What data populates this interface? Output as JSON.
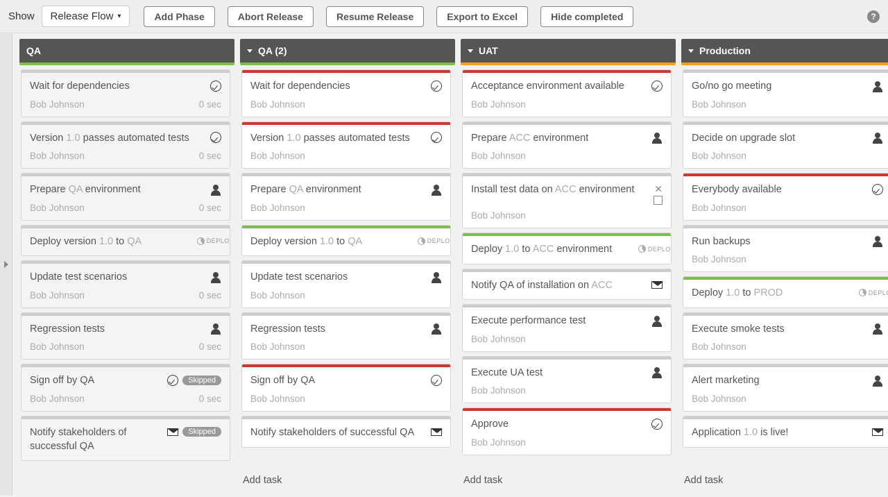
{
  "toolbar": {
    "show_label": "Show",
    "view_dropdown": "Release Flow",
    "add_phase": "Add Phase",
    "abort_release": "Abort Release",
    "resume_release": "Resume Release",
    "export_excel": "Export to Excel",
    "hide_completed": "Hide completed"
  },
  "add_task_label": "Add task",
  "phases": [
    {
      "name": "QA",
      "strip": "green",
      "expanded": false,
      "tasks": [
        {
          "pre": "",
          "mid": "",
          "post": "Wait for dependencies",
          "bar": "grey",
          "bg": "completed",
          "icon": "check",
          "assignee": "Bob Johnson",
          "meta": "0 sec"
        },
        {
          "pre": "Version ",
          "mid": "1.0",
          "post": " passes automated tests",
          "bar": "grey",
          "bg": "completed",
          "icon": "check",
          "assignee": "Bob Johnson",
          "meta": "0 sec"
        },
        {
          "pre": "Prepare ",
          "mid": "QA",
          "post": " environment",
          "bar": "grey",
          "bg": "completed",
          "icon": "person",
          "assignee": "Bob Johnson",
          "meta": "0 sec"
        },
        {
          "pre": "Deploy version ",
          "mid": "1.0",
          "post": " to ",
          "mid2": "QA",
          "bar": "grey",
          "bg": "completed",
          "icon": "deploy",
          "assignee": "",
          "meta": ""
        },
        {
          "pre": "",
          "mid": "",
          "post": "Update test scenarios",
          "bar": "grey",
          "bg": "completed",
          "icon": "person",
          "assignee": "Bob Johnson",
          "meta": "0 sec"
        },
        {
          "pre": "",
          "mid": "",
          "post": "Regression tests",
          "bar": "grey",
          "bg": "completed",
          "icon": "person",
          "assignee": "Bob Johnson",
          "meta": "0 sec"
        },
        {
          "pre": "",
          "mid": "",
          "post": "Sign off by QA",
          "bar": "grey",
          "bg": "completed",
          "icon": "check",
          "badge": "Skipped",
          "assignee": "Bob Johnson",
          "meta": "0 sec"
        },
        {
          "pre": "",
          "mid": "",
          "post": "Notify stakeholders of successful QA",
          "bar": "grey",
          "bg": "completed",
          "icon": "mail",
          "badge": "Skipped",
          "assignee": "",
          "meta": ""
        }
      ]
    },
    {
      "name": "QA (2)",
      "strip": "green",
      "expanded": true,
      "tasks": [
        {
          "pre": "",
          "mid": "",
          "post": "Wait for dependencies",
          "bar": "red",
          "icon": "check",
          "assignee": "Bob Johnson",
          "meta": ""
        },
        {
          "pre": "Version ",
          "mid": "1.0",
          "post": " passes automated tests",
          "bar": "red",
          "icon": "check",
          "assignee": "Bob Johnson",
          "meta": ""
        },
        {
          "pre": "Prepare ",
          "mid": "QA",
          "post": " environment",
          "bar": "grey",
          "icon": "person",
          "assignee": "Bob Johnson",
          "meta": ""
        },
        {
          "pre": "Deploy version ",
          "mid": "1.0",
          "post": " to ",
          "mid2": "QA",
          "bar": "green",
          "icon": "deploy",
          "assignee": "",
          "meta": ""
        },
        {
          "pre": "",
          "mid": "",
          "post": "Update test scenarios",
          "bar": "grey",
          "icon": "person",
          "assignee": "Bob Johnson",
          "meta": ""
        },
        {
          "pre": "",
          "mid": "",
          "post": "Regression tests",
          "bar": "grey",
          "icon": "person",
          "assignee": "Bob Johnson",
          "meta": ""
        },
        {
          "pre": "",
          "mid": "",
          "post": "Sign off by QA",
          "bar": "red",
          "icon": "check",
          "assignee": "Bob Johnson",
          "meta": ""
        },
        {
          "pre": "",
          "mid": "",
          "post": "Notify stakeholders of successful QA",
          "bar": "grey",
          "icon": "mail",
          "assignee": "",
          "meta": ""
        }
      ]
    },
    {
      "name": "UAT",
      "strip": "orange",
      "expanded": true,
      "tasks": [
        {
          "pre": "",
          "mid": "",
          "post": "Acceptance environment available",
          "bar": "red",
          "icon": "check",
          "assignee": "Bob Johnson",
          "meta": ""
        },
        {
          "pre": "Prepare ",
          "mid": "ACC",
          "post": " environment",
          "bar": "grey",
          "icon": "person",
          "assignee": "Bob Johnson",
          "meta": ""
        },
        {
          "pre": "Install test data on ",
          "mid": "ACC",
          "post": " environment",
          "bar": "grey",
          "icon": "person",
          "extras": true,
          "assignee": "Bob Johnson",
          "meta": ""
        },
        {
          "pre": "Deploy ",
          "mid": "1.0",
          "post": " to ",
          "mid2": "ACC",
          "post2": " environment",
          "bar": "green",
          "icon": "deploy",
          "assignee": "",
          "meta": ""
        },
        {
          "pre": "Notify QA of installation on ",
          "mid": "ACC",
          "post": "",
          "bar": "grey",
          "icon": "mail",
          "assignee": "",
          "meta": ""
        },
        {
          "pre": "",
          "mid": "",
          "post": "Execute performance test",
          "bar": "grey",
          "icon": "person",
          "assignee": "Bob Johnson",
          "meta": ""
        },
        {
          "pre": "",
          "mid": "",
          "post": "Execute UA test",
          "bar": "grey",
          "icon": "person",
          "assignee": "Bob Johnson",
          "meta": ""
        },
        {
          "pre": "",
          "mid": "",
          "post": "Approve",
          "bar": "red",
          "icon": "check",
          "assignee": "Bob Johnson",
          "meta": ""
        }
      ]
    },
    {
      "name": "Production",
      "strip": "orange",
      "expanded": true,
      "tasks": [
        {
          "pre": "",
          "mid": "",
          "post": "Go/no go meeting",
          "bar": "grey",
          "icon": "person",
          "assignee": "Bob Johnson",
          "meta": ""
        },
        {
          "pre": "",
          "mid": "",
          "post": "Decide on upgrade slot",
          "bar": "grey",
          "icon": "person",
          "assignee": "Bob Johnson",
          "meta": ""
        },
        {
          "pre": "",
          "mid": "",
          "post": "Everybody available",
          "bar": "red",
          "icon": "check",
          "assignee": "Bob Johnson",
          "meta": ""
        },
        {
          "pre": "",
          "mid": "",
          "post": "Run backups",
          "bar": "grey",
          "icon": "person",
          "assignee": "Bob Johnson",
          "meta": ""
        },
        {
          "pre": "Deploy ",
          "mid": "1.0",
          "post": " to ",
          "mid2": "PROD",
          "bar": "green",
          "icon": "deploy",
          "assignee": "",
          "meta": ""
        },
        {
          "pre": "",
          "mid": "",
          "post": "Execute smoke tests",
          "bar": "grey",
          "icon": "person",
          "assignee": "Bob Johnson",
          "meta": ""
        },
        {
          "pre": "",
          "mid": "",
          "post": "Alert marketing",
          "bar": "grey",
          "icon": "person",
          "assignee": "Bob Johnson",
          "meta": ""
        },
        {
          "pre": "Application ",
          "mid": "1.0",
          "post": " is live!",
          "bar": "grey",
          "icon": "mail",
          "assignee": "",
          "meta": ""
        }
      ]
    }
  ]
}
